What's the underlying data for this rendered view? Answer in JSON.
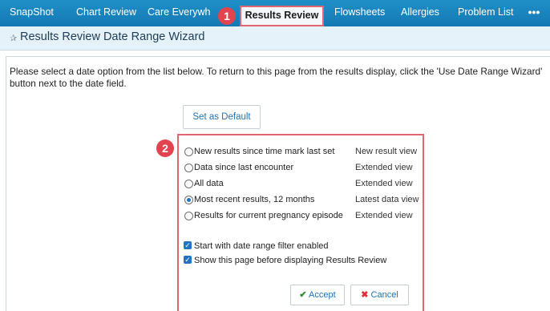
{
  "tabs": [
    {
      "label": "SnapShot"
    },
    {
      "label": "Chart Review"
    },
    {
      "label": "Care Everywh"
    },
    {
      "label": "Results Review"
    },
    {
      "label": "Flowsheets"
    },
    {
      "label": "Allergies"
    },
    {
      "label": "Problem List"
    }
  ],
  "more_label": "•••",
  "callouts": [
    "1",
    "2"
  ],
  "header": {
    "pin_icon": "pin-icon",
    "title": "Results Review Date Range Wizard"
  },
  "instructions": "Please select a date option from the list below. To return to this page from the results display, click the 'Use Date Range Wizard' button next to the date field.",
  "default_button": "Set as Default",
  "options": [
    {
      "label": "New results since time mark last set",
      "view": "New result view",
      "selected": false
    },
    {
      "label": "Data since last encounter",
      "view": "Extended view",
      "selected": false
    },
    {
      "label": "All data",
      "view": "Extended view",
      "selected": false
    },
    {
      "label": "Most recent results, 12 months",
      "view": "Latest data view",
      "selected": true
    },
    {
      "label": "Results for current pregnancy episode",
      "view": "Extended view",
      "selected": false
    }
  ],
  "checkboxes": [
    {
      "label": "Start with date range filter enabled",
      "checked": true
    },
    {
      "label": "Show this page before displaying Results Review",
      "checked": true
    }
  ],
  "buttons": {
    "accept": "Accept",
    "cancel": "Cancel"
  },
  "colors": {
    "tab_bar": "#1479b3",
    "highlight": "#e36570",
    "link": "#1a73b8",
    "accent": "#1f74c6"
  }
}
